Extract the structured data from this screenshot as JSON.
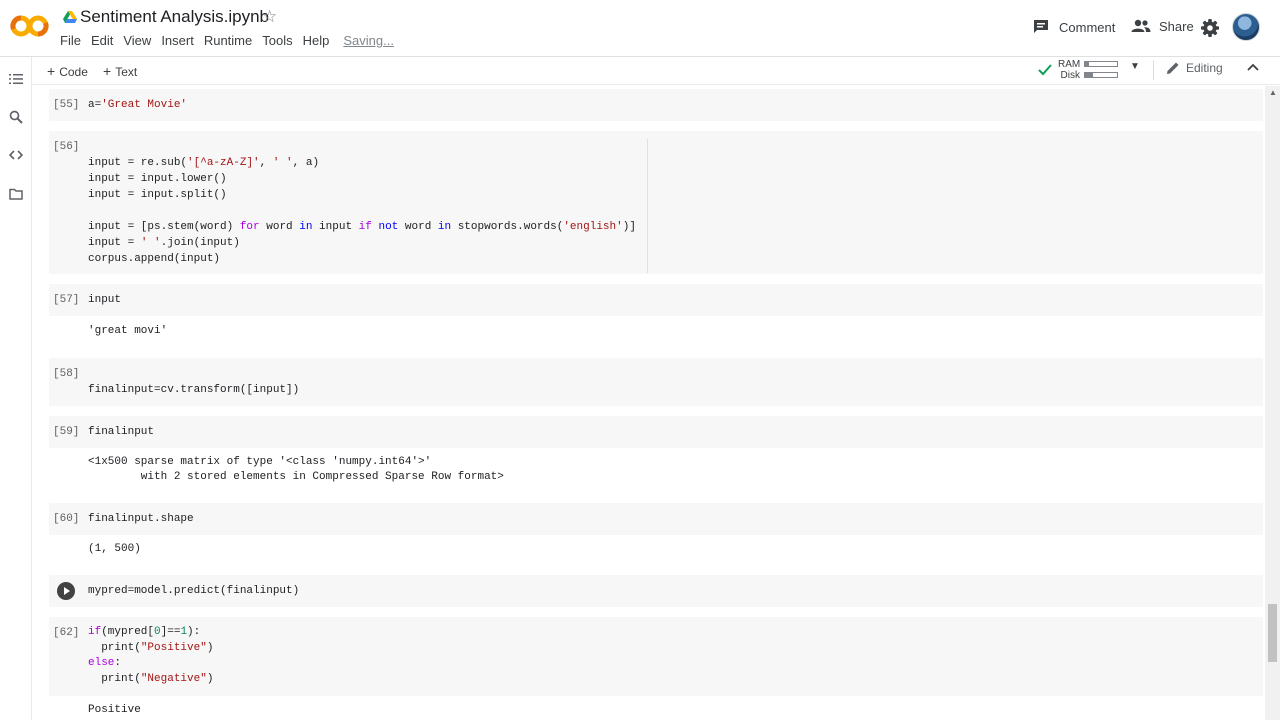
{
  "header": {
    "title": "Sentiment Analysis.ipynb",
    "logo_text": "CO",
    "menu": [
      "File",
      "Edit",
      "View",
      "Insert",
      "Runtime",
      "Tools",
      "Help"
    ],
    "status": "Saving...",
    "comment_label": "Comment",
    "share_label": "Share"
  },
  "toolbar": {
    "add_code": "Code",
    "add_text": "Text",
    "ram_label": "RAM",
    "disk_label": "Disk",
    "ram_usage": 0.12,
    "disk_usage": 0.25,
    "editing_label": "Editing"
  },
  "colors": {
    "logo_orange": "#F9AB00",
    "logo_orange_dark": "#E8710A",
    "check_green": "#0F9D58",
    "string": "#A31515",
    "keyword": "#AF00DB"
  },
  "icons": [
    "table-of-contents-icon",
    "search-icon",
    "code-snippets-icon",
    "folder-icon",
    "comment-icon",
    "people-icon",
    "gear-icon",
    "pencil-icon",
    "chevron-up-icon",
    "check-icon",
    "star-icon",
    "drive-icon",
    "play-icon"
  ],
  "cells": [
    {
      "exec": "[55]",
      "code": [
        "a='Great Movie'"
      ]
    },
    {
      "exec": "[56]",
      "code": [
        "",
        "input = re.sub('[^a-zA-Z]', ' ', a)",
        "input = input.lower()",
        "input = input.split()",
        "",
        "input = [ps.stem(word) for word in input if not word in stopwords.words('english')]",
        "input = ' '.join(input)",
        "corpus.append(input)"
      ]
    },
    {
      "exec": "[57]",
      "code": [
        "input"
      ],
      "output": "'great movi'"
    },
    {
      "exec": "[58]",
      "code": [
        "",
        "finalinput=cv.transform([input])"
      ]
    },
    {
      "exec": "[59]",
      "code": [
        "finalinput"
      ],
      "output": "<1x500 sparse matrix of type '<class 'numpy.int64'>'\n        with 2 stored elements in Compressed Sparse Row format>"
    },
    {
      "exec": "[60]",
      "code": [
        "finalinput.shape"
      ],
      "output": "(1, 500)"
    },
    {
      "exec": "",
      "code": [
        "mypred=model.predict(finalinput)"
      ]
    },
    {
      "exec": "[62]",
      "code": [
        "if(mypred[0]==1):",
        "  print(\"Positive\")",
        "else:",
        "  print(\"Negative\")"
      ],
      "output": "Positive"
    }
  ]
}
